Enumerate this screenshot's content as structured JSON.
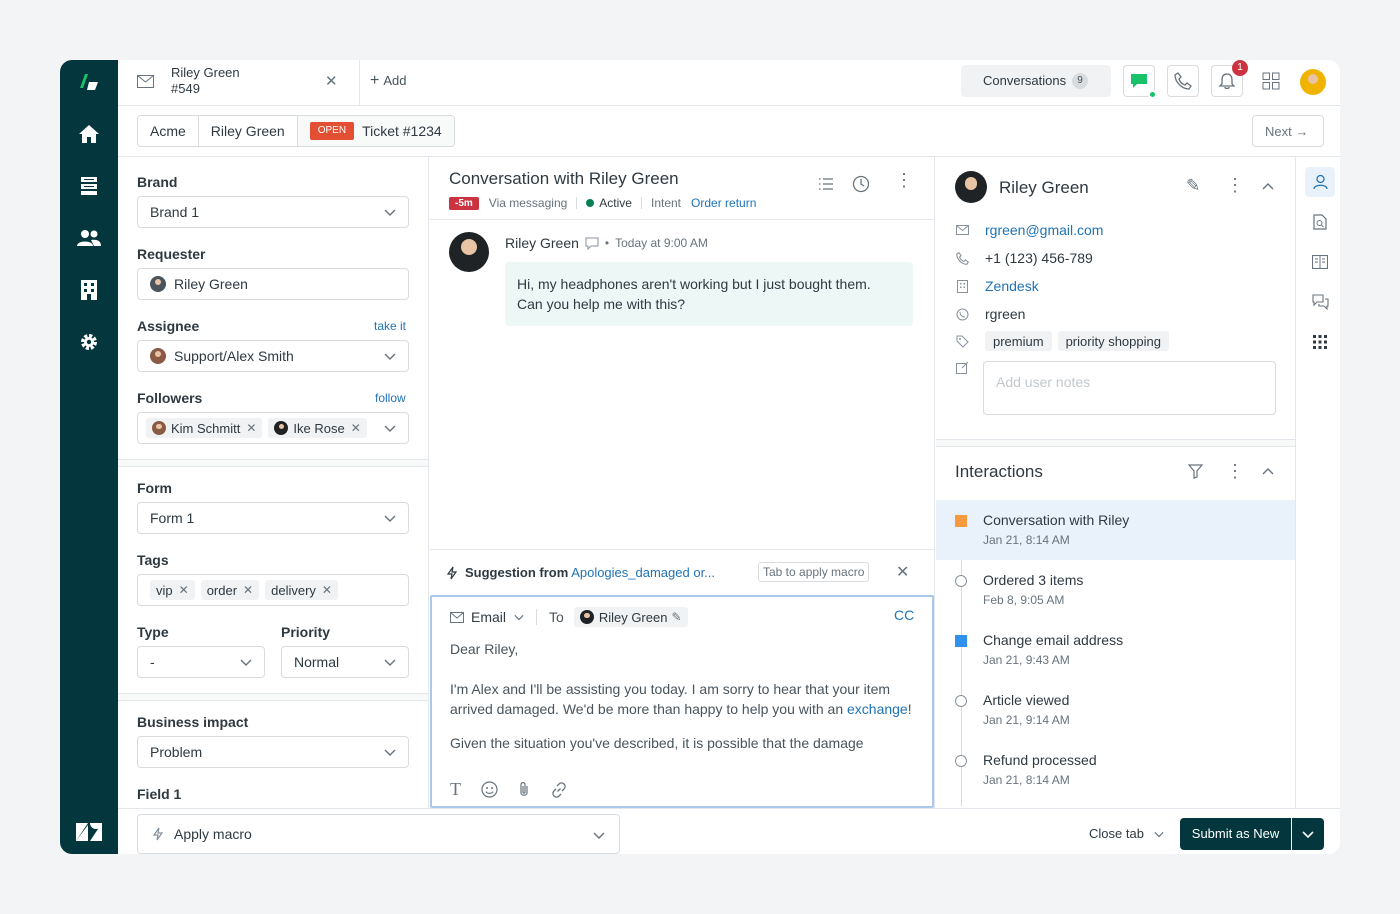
{
  "tab": {
    "name": "Riley Green",
    "number": "#549",
    "add_label": "Add"
  },
  "topbar": {
    "conversations_label": "Conversations",
    "conversations_count": "9",
    "notification_count": "1"
  },
  "breadcrumb": {
    "org": "Acme",
    "requester": "Riley Green",
    "status": "OPEN",
    "ticket": "Ticket #1234"
  },
  "next_label": "Next",
  "left": {
    "brand_label": "Brand",
    "brand_value": "Brand 1",
    "requester_label": "Requester",
    "requester_value": "Riley Green",
    "assignee_label": "Assignee",
    "assignee_action": "take it",
    "assignee_value": "Support/Alex Smith",
    "followers_label": "Followers",
    "followers_action": "follow",
    "followers": [
      "Kim Schmitt",
      "Ike Rose"
    ],
    "form_label": "Form",
    "form_value": "Form 1",
    "tags_label": "Tags",
    "tags": [
      "vip",
      "order",
      "delivery"
    ],
    "type_label": "Type",
    "type_value": "-",
    "priority_label": "Priority",
    "priority_value": "Normal",
    "impact_label": "Business impact",
    "impact_value": "Problem",
    "field1_label": "Field 1"
  },
  "conversation": {
    "title": "Conversation with Riley Green",
    "time_badge": "-5m",
    "channel": "Via messaging",
    "status": "Active",
    "intent_label": "Intent",
    "intent_value": "Order return",
    "author": "Riley Green",
    "timestamp": "Today at 9:00 AM",
    "message_line1": "Hi, my headphones aren't working but I just bought them.",
    "message_line2": "Can you help me with this?"
  },
  "suggestion": {
    "prefix": "Suggestion from",
    "macro": "Apologies_damaged or...",
    "hint": "Tab to apply macro"
  },
  "editor": {
    "channel": "Email",
    "to_label": "To",
    "recipient": "Riley Green",
    "cc_label": "CC",
    "greeting": "Dear Riley,",
    "body": "I'm Alex and I'll be assisting you today. I am sorry to hear that your item arrived damaged. We'd be more than happy to help you with an ",
    "link": "exchange",
    "link_suffix": "!",
    "more": "Given the situation you've described, it is possible that the damage"
  },
  "profile": {
    "name": "Riley Green",
    "email": "rgreen@gmail.com",
    "phone": "+1 (123) 456-789",
    "org": "Zendesk",
    "handle": "rgreen",
    "tags": [
      "premium",
      "priority shopping"
    ],
    "notes_placeholder": "Add user notes"
  },
  "interactions": {
    "title": "Interactions",
    "items": [
      {
        "title": "Conversation with Riley",
        "date": "Jan 21, 8:14 AM"
      },
      {
        "title": "Ordered 3 items",
        "date": "Feb 8, 9:05 AM"
      },
      {
        "title": "Change email address",
        "date": "Jan 21, 9:43 AM"
      },
      {
        "title": "Article viewed",
        "date": "Jan 21, 9:14 AM"
      },
      {
        "title": "Refund processed",
        "date": "Jan 21, 8:14 AM"
      }
    ]
  },
  "footer": {
    "macro_label": "Apply macro",
    "close_tab": "Close tab",
    "submit": "Submit as New"
  },
  "colors": {
    "rail": "#03363d",
    "accent": "#1f73b7",
    "open": "#e34f32",
    "danger": "#cc3340",
    "active": "#038153"
  }
}
